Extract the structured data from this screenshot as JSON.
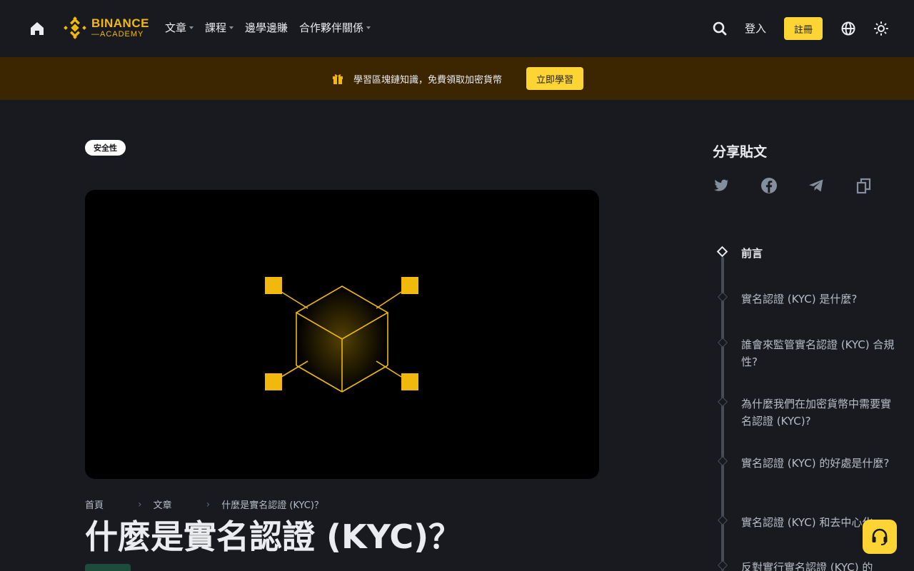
{
  "header": {
    "logo_title": "BINANCE",
    "logo_sub": "—ACADEMY",
    "nav": [
      {
        "label": "文章",
        "dropdown": true
      },
      {
        "label": "課程",
        "dropdown": true
      },
      {
        "label": "邊學邊賺",
        "dropdown": false
      },
      {
        "label": "合作夥伴關係",
        "dropdown": true
      }
    ],
    "login_label": "登入",
    "register_label": "註冊"
  },
  "banner": {
    "text": "學習區塊鏈知識，免費領取加密貨幣",
    "button_label": "立即學習"
  },
  "article": {
    "tag": "安全性",
    "breadcrumb": [
      "首頁",
      "文章",
      "什麼是實名認證 (KYC)？"
    ],
    "title": "什麼是實名認證 (KYC)？"
  },
  "share": {
    "title": "分享貼文",
    "icons": [
      "twitter-icon",
      "facebook-icon",
      "telegram-icon",
      "copy-icon"
    ]
  },
  "toc": [
    {
      "label": "前言",
      "active": true
    },
    {
      "label": "實名認證 (KYC) 是什麼?",
      "active": false
    },
    {
      "label": "誰會來監管實名認證 (KYC) 合規性?",
      "active": false
    },
    {
      "label": "為什麼我們在加密貨幣中需要實名認證 (KYC)?",
      "active": false
    },
    {
      "label": "實名認證 (KYC) 的好處是什麼?",
      "active": false
    },
    {
      "label": "實名認證 (KYC) 和去中心化",
      "active": false
    },
    {
      "label": "反對實行實名認證 (KYC) 的",
      "active": false
    }
  ],
  "colors": {
    "accent": "#fcd535",
    "brand": "#f0b90b",
    "background": "#181a20",
    "banner": "#3c2601"
  }
}
